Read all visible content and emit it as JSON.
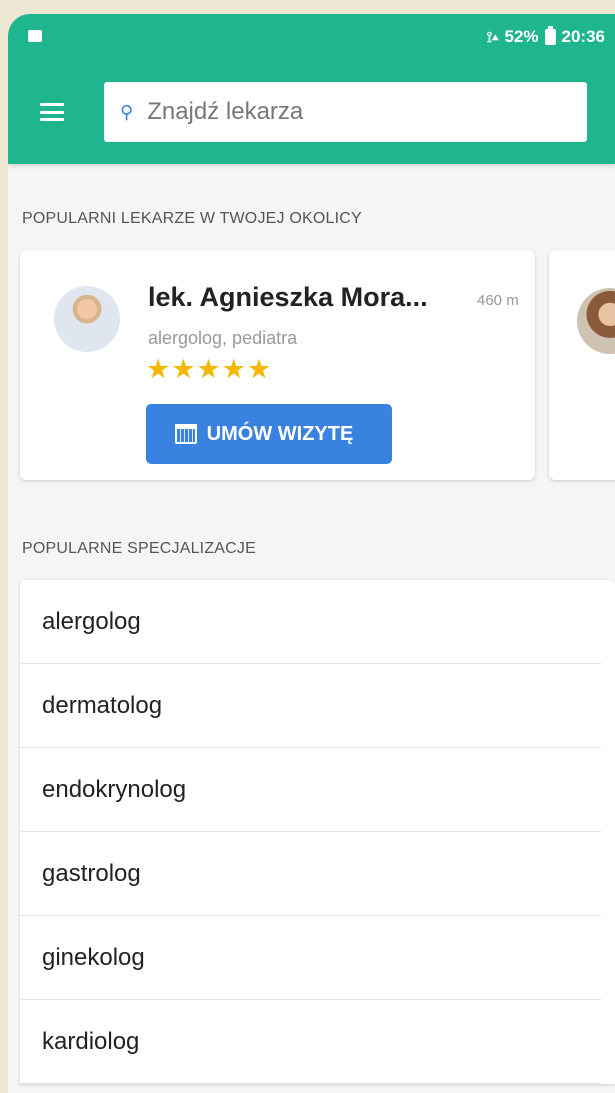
{
  "statusbar": {
    "left_icon": "gallery-icon",
    "signal_text": "52%",
    "time": "20:36"
  },
  "search": {
    "placeholder": "Znajdź lekarza"
  },
  "popular_doctors": {
    "title": "POPULARNI LEKARZE W TWOJEJ OKOLICY",
    "cards": [
      {
        "name": "lek. Agnieszka Mora...",
        "distance": "460 m",
        "specialties": "alergolog, pediatra",
        "rating": 5,
        "stars": "★★★★★",
        "button": "UMÓW WIZYTĘ"
      }
    ]
  },
  "popular_specializations": {
    "title": "POPULARNE SPECJALIZACJE",
    "items": [
      "alergolog",
      "dermatolog",
      "endokrynolog",
      "gastrolog",
      "ginekolog",
      "kardiolog"
    ]
  },
  "colors": {
    "primary": "#1fb58e",
    "button": "#3a82e0",
    "stars": "#f5b700"
  }
}
